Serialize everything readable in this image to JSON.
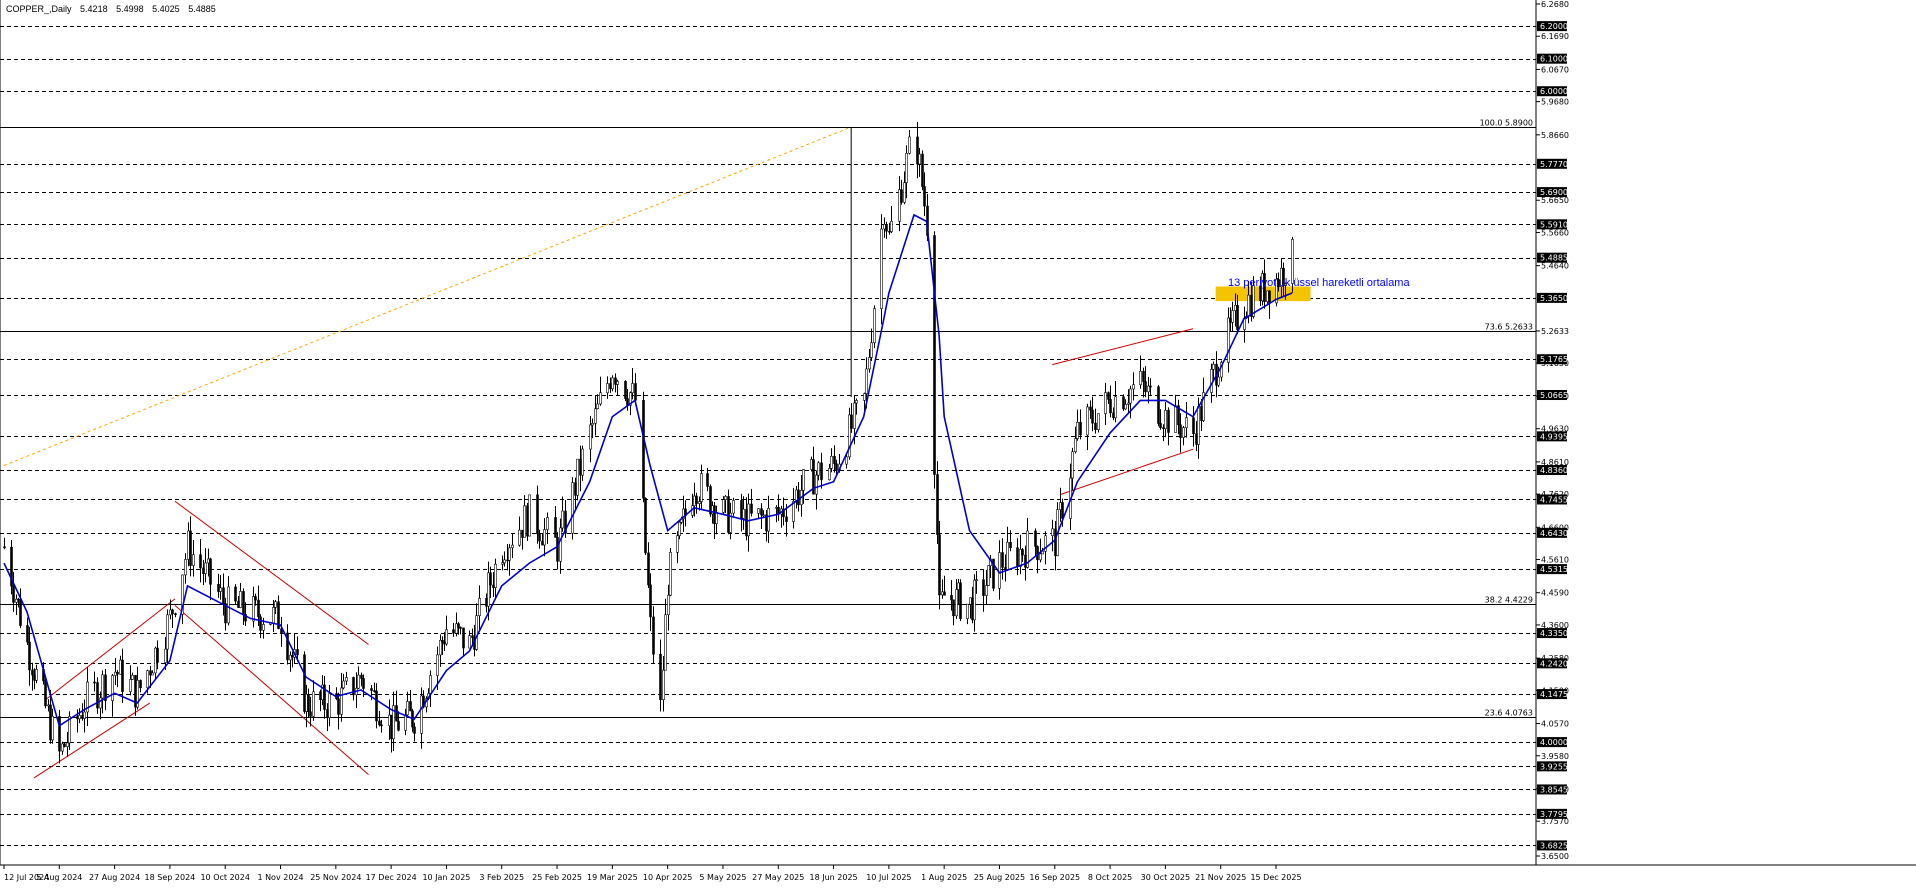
{
  "header": {
    "symbol": "COPPER_,Daily",
    "open": "5.4218",
    "high": "5.4998",
    "low": "5.4025",
    "close": "5.4885"
  },
  "annotation": "13 periyotluk üssel hareketli ortalama",
  "fib_levels": [
    {
      "label": "100.0 5.8900",
      "value": 5.89
    },
    {
      "label": "73.6 5.2633",
      "value": 5.2633
    },
    {
      "label": "38.2 4.4229",
      "value": 4.4229
    },
    {
      "label": "23.6 4.0763",
      "value": 4.0763
    }
  ],
  "chart_data": {
    "type": "candlestick",
    "title": "COPPER_,Daily",
    "ylim": [
      3.65,
      6.268
    ],
    "highlighted_price_labels": [
      "6.2000",
      "6.1000",
      "6.0000",
      "5.7770",
      "5.6900",
      "5.5910",
      "5.4885",
      "5.3650",
      "5.1765",
      "5.0665",
      "4.9395",
      "4.8360",
      "4.7455",
      "4.6430",
      "4.5315",
      "4.3350",
      "4.2420",
      "4.1475",
      "4.0000",
      "3.9255",
      "3.8545",
      "3.7795",
      "3.6825"
    ],
    "minor_price_labels": [
      "6.2680",
      "6.1690",
      "6.0670",
      "5.9680",
      "5.8660",
      "5.6650",
      "5.5660",
      "5.4640",
      "5.2633",
      "5.1650",
      "5.0630",
      "4.9630",
      "4.8610",
      "4.7620",
      "4.6600",
      "4.5610",
      "4.4590",
      "4.3600",
      "4.2580",
      "4.1590",
      "4.0570",
      "3.9580",
      "3.8560",
      "3.7570",
      "3.6500"
    ],
    "x_tick_labels": [
      "12 Jul 2024",
      "5 Aug 2024",
      "27 Aug 2024",
      "18 Sep 2024",
      "10 Oct 2024",
      "1 Nov 2024",
      "25 Nov 2024",
      "17 Dec 2024",
      "10 Jan 2025",
      "3 Feb 2025",
      "25 Feb 2025",
      "19 Mar 2025",
      "10 Apr 2025",
      "5 May 2025",
      "27 May 2025",
      "18 Jun 2025",
      "10 Jul 2025",
      "1 Aug 2025",
      "25 Aug 2025",
      "16 Sep 2025",
      "8 Oct 2025",
      "30 Oct 2025",
      "21 Nov 2025",
      "15 Dec 2025"
    ],
    "close_path": [
      [
        "12 Jul 2024",
        4.6
      ],
      [
        "22 Jul 2024",
        4.3
      ],
      [
        "5 Aug 2024",
        3.96
      ],
      [
        "15 Aug 2024",
        4.12
      ],
      [
        "27 Aug 2024",
        4.22
      ],
      [
        "5 Sep 2024",
        4.15
      ],
      [
        "18 Sep 2024",
        4.38
      ],
      [
        "25 Sep 2024",
        4.6
      ],
      [
        "10 Oct 2024",
        4.42
      ],
      [
        "20 Oct 2024",
        4.4
      ],
      [
        "1 Nov 2024",
        4.38
      ],
      [
        "12 Nov 2024",
        4.12
      ],
      [
        "25 Nov 2024",
        4.12
      ],
      [
        "5 Dec 2024",
        4.2
      ],
      [
        "17 Dec 2024",
        4.05
      ],
      [
        "27 Dec 2024",
        4.08
      ],
      [
        "10 Jan 2025",
        4.35
      ],
      [
        "20 Jan 2025",
        4.3
      ],
      [
        "3 Feb 2025",
        4.6
      ],
      [
        "14 Feb 2025",
        4.7
      ],
      [
        "25 Feb 2025",
        4.6
      ],
      [
        "10 Mar 2025",
        4.95
      ],
      [
        "19 Mar 2025",
        5.15
      ],
      [
        "28 Mar 2025",
        5.05
      ],
      [
        "3 Apr 2025",
        4.35
      ],
      [
        "7 Apr 2025",
        4.1
      ],
      [
        "10 Apr 2025",
        4.5
      ],
      [
        "22 Apr 2025",
        4.8
      ],
      [
        "5 May 2025",
        4.7
      ],
      [
        "15 May 2025",
        4.68
      ],
      [
        "27 May 2025",
        4.7
      ],
      [
        "10 Jun 2025",
        4.82
      ],
      [
        "18 Jun 2025",
        4.85
      ],
      [
        "30 Jun 2025",
        5.05
      ],
      [
        "8 Jul 2025",
        5.65
      ],
      [
        "10 Jul 2025",
        5.55
      ],
      [
        "20 Jul 2025",
        5.88
      ],
      [
        "25 Jul 2025",
        5.6
      ],
      [
        "30 Jul 2025",
        4.4
      ],
      [
        "1 Aug 2025",
        4.45
      ],
      [
        "12 Aug 2025",
        4.42
      ],
      [
        "25 Aug 2025",
        4.55
      ],
      [
        "5 Sep 2025",
        4.6
      ],
      [
        "16 Sep 2025",
        4.62
      ],
      [
        "25 Sep 2025",
        4.95
      ],
      [
        "8 Oct 2025",
        5.05
      ],
      [
        "20 Oct 2025",
        5.1
      ],
      [
        "30 Oct 2025",
        5.0
      ],
      [
        "10 Nov 2025",
        4.95
      ],
      [
        "21 Nov 2025",
        5.2
      ],
      [
        "1 Dec 2025",
        5.35
      ],
      [
        "15 Dec 2025",
        5.42
      ],
      [
        "22 Dec 2025",
        5.4885
      ]
    ],
    "series": [
      {
        "name": "13 periyotluk üssel hareketli ortalama",
        "color": "#0000cc",
        "values": [
          [
            "12 Jul 2024",
            4.55
          ],
          [
            "22 Jul 2024",
            4.4
          ],
          [
            "5 Aug 2024",
            4.05
          ],
          [
            "15 Aug 2024",
            4.1
          ],
          [
            "27 Aug 2024",
            4.15
          ],
          [
            "5 Sep 2024",
            4.12
          ],
          [
            "18 Sep 2024",
            4.25
          ],
          [
            "25 Sep 2024",
            4.48
          ],
          [
            "10 Oct 2024",
            4.42
          ],
          [
            "20 Oct 2024",
            4.38
          ],
          [
            "1 Nov 2024",
            4.36
          ],
          [
            "12 Nov 2024",
            4.2
          ],
          [
            "25 Nov 2024",
            4.14
          ],
          [
            "5 Dec 2024",
            4.16
          ],
          [
            "17 Dec 2024",
            4.1
          ],
          [
            "27 Dec 2024",
            4.07
          ],
          [
            "10 Jan 2025",
            4.22
          ],
          [
            "20 Jan 2025",
            4.28
          ],
          [
            "3 Feb 2025",
            4.48
          ],
          [
            "14 Feb 2025",
            4.55
          ],
          [
            "25 Feb 2025",
            4.6
          ],
          [
            "10 Mar 2025",
            4.8
          ],
          [
            "19 Mar 2025",
            5.0
          ],
          [
            "28 Mar 2025",
            5.05
          ],
          [
            "3 Apr 2025",
            4.85
          ],
          [
            "10 Apr 2025",
            4.65
          ],
          [
            "22 Apr 2025",
            4.72
          ],
          [
            "5 May 2025",
            4.7
          ],
          [
            "15 May 2025",
            4.68
          ],
          [
            "27 May 2025",
            4.7
          ],
          [
            "10 Jun 2025",
            4.78
          ],
          [
            "18 Jun 2025",
            4.8
          ],
          [
            "30 Jun 2025",
            5.0
          ],
          [
            "8 Jul 2025",
            5.3
          ],
          [
            "10 Jul 2025",
            5.38
          ],
          [
            "20 Jul 2025",
            5.62
          ],
          [
            "25 Jul 2025",
            5.6
          ],
          [
            "30 Jul 2025",
            5.25
          ],
          [
            "1 Aug 2025",
            5.0
          ],
          [
            "12 Aug 2025",
            4.65
          ],
          [
            "25 Aug 2025",
            4.52
          ],
          [
            "5 Sep 2025",
            4.55
          ],
          [
            "16 Sep 2025",
            4.62
          ],
          [
            "25 Sep 2025",
            4.8
          ],
          [
            "8 Oct 2025",
            4.95
          ],
          [
            "20 Oct 2025",
            5.05
          ],
          [
            "30 Oct 2025",
            5.05
          ],
          [
            "10 Nov 2025",
            5.0
          ],
          [
            "21 Nov 2025",
            5.15
          ],
          [
            "1 Dec 2025",
            5.3
          ],
          [
            "15 Dec 2025",
            5.36
          ],
          [
            "22 Dec 2025",
            5.38
          ]
        ]
      }
    ],
    "support_zone": {
      "from": 5.355,
      "to": 5.4,
      "start": "19 Nov 2025",
      "end": "30 Dec 2025",
      "color": "#f5c400"
    },
    "trend_channels": [
      {
        "color": "#cc0000",
        "lines": [
          [
            [
              "30 Jul 2024",
              4.13
            ],
            [
              "20 Sep 2024",
              4.44
            ]
          ],
          [
            [
              "25 Jul 2024",
              3.89
            ],
            [
              "10 Sep 2024",
              4.12
            ]
          ]
        ]
      },
      {
        "color": "#cc0000",
        "lines": [
          [
            [
              "20 Sep 2024",
              4.74
            ],
            [
              "8 Dec 2024",
              4.3
            ]
          ],
          [
            [
              "20 Sep 2024",
              4.42
            ],
            [
              "8 Dec 2024",
              3.9
            ]
          ]
        ]
      },
      {
        "color": "#cc0000",
        "lines": [
          [
            [
              "15 Sep 2025",
              5.16
            ],
            [
              "10 Nov 2025",
              5.27
            ]
          ],
          [
            [
              "18 Sep 2025",
              4.76
            ],
            [
              "10 Nov 2025",
              4.9
            ]
          ]
        ]
      }
    ],
    "fib_trendline": {
      "color": "#ffa500",
      "from": [
        "12 Jul 2024",
        4.85
      ],
      "to": [
        "25 Jun 2025",
        5.89
      ]
    },
    "grid": true
  }
}
